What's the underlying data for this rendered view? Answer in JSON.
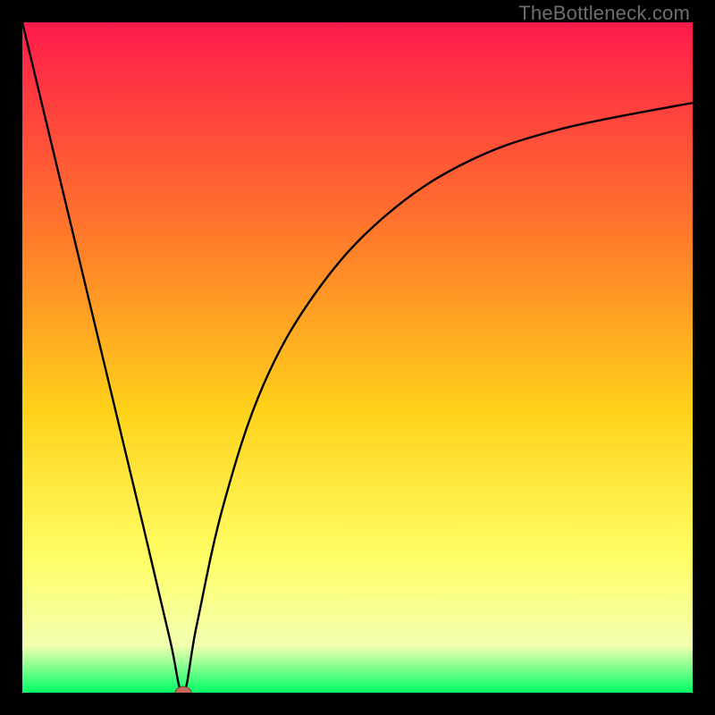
{
  "watermark": "TheBottleneck.com",
  "colors": {
    "top": "#ff1a4b",
    "mid_upper": "#ff7a2a",
    "mid": "#ffd21a",
    "mid_lower": "#ffff66",
    "near_bottom": "#f3ffb0",
    "bottom": "#00ff66",
    "curve": "#000000",
    "marker_fill": "#c46a5a",
    "marker_stroke": "#7d3c30"
  },
  "chart_data": {
    "type": "line",
    "title": "",
    "xlabel": "",
    "ylabel": "",
    "xlim": [
      0,
      100
    ],
    "ylim": [
      0,
      100
    ],
    "x_min_at": 24,
    "left_branch": {
      "x": [
        0,
        6,
        12,
        18,
        22,
        24
      ],
      "y": [
        100,
        75,
        50,
        25,
        8,
        0
      ]
    },
    "right_branch": {
      "x": [
        24,
        26,
        30,
        36,
        44,
        54,
        66,
        80,
        100
      ],
      "y": [
        0,
        10,
        28,
        46,
        60,
        71,
        79,
        84,
        88
      ]
    },
    "marker": {
      "x": 24,
      "y": 0,
      "rx": 1.2,
      "ry": 0.9
    }
  }
}
